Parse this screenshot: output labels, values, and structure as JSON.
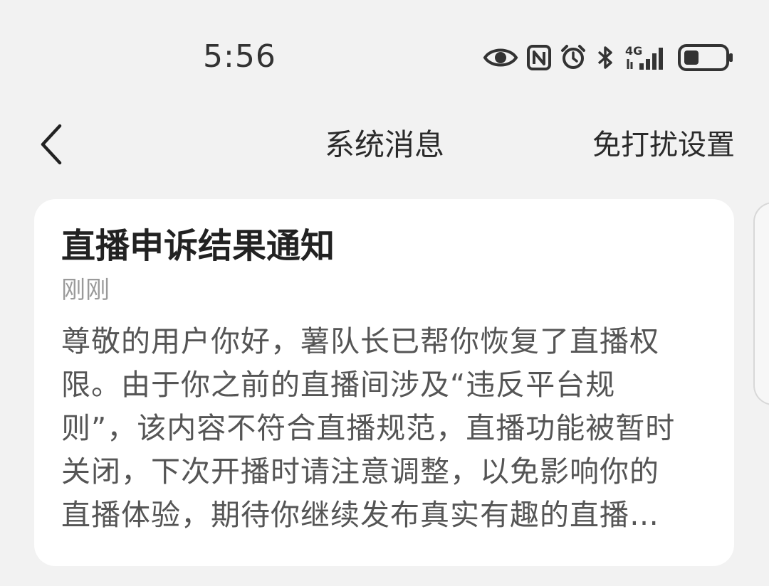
{
  "status_bar": {
    "time": "5:56",
    "network_label": "4G",
    "icons": [
      "eye-icon",
      "nfc-icon",
      "alarm-icon",
      "bluetooth-icon",
      "signal-4g-icon",
      "battery-icon"
    ]
  },
  "nav": {
    "back_icon": "chevron-left-icon",
    "title": "系统消息",
    "dnd_label": "免打扰设置"
  },
  "message": {
    "title": "直播申诉结果通知",
    "time": "刚刚",
    "body": "尊敬的用户你好，薯队长已帮你恢复了直播权限。由于你之前的直播间涉及“违反平台规则”，该内容不符合直播规范，直播功能被暂时关闭，下次开播时请注意调整，以免影响你的直播体验，期待你继续发布真实有趣的直播内容。"
  }
}
